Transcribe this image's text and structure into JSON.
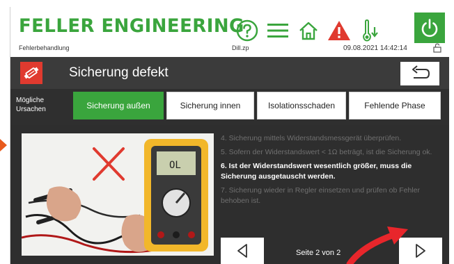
{
  "header": {
    "brand": "FELLER ENGINEERING",
    "status_left": "Fehlerbehandlung",
    "status_mid": "Dill.zp",
    "datetime": "09.08.2021 14:42:14"
  },
  "icons": [
    "help-icon",
    "menu-icon",
    "home-icon",
    "warning-icon",
    "temperature-icon",
    "power-icon",
    "lock-icon",
    "fuse-icon",
    "undo-arrow-icon",
    "arrow-left-icon",
    "arrow-right-icon"
  ],
  "colors": {
    "brand_green": "#3aa53d",
    "alarm_red": "#e03a2f",
    "panel_dark": "#3b3b3b"
  },
  "title": "Sicherung defekt",
  "causes": {
    "label": "Mögliche Ursachen",
    "tabs": [
      {
        "label": "Sicherung außen",
        "active": true
      },
      {
        "label": "Sicherung innen",
        "active": false
      },
      {
        "label": "Isolationsschaden",
        "active": false
      },
      {
        "label": "Fehlende Phase",
        "active": false
      }
    ]
  },
  "steps": [
    {
      "text": "4. Sicherung mittels Widerstandsmessgerät überprüfen.",
      "active": false
    },
    {
      "text": "5. Sofern der Widerstandswert < 1Ω beträgt, ist die Sicherung ok.",
      "active": false
    },
    {
      "text": "6. Ist der Widerstandswert wesentlich größer, muss die Sicherung ausgetauscht werden.",
      "active": true
    },
    {
      "text": "7. Sicherung wieder in Regler einsetzen und prüfen ob Fehler behoben ist.",
      "active": false
    }
  ],
  "pagination": {
    "label": "Seite 2 von 2",
    "current": 2,
    "total": 2
  },
  "multimeter_display": "OL"
}
